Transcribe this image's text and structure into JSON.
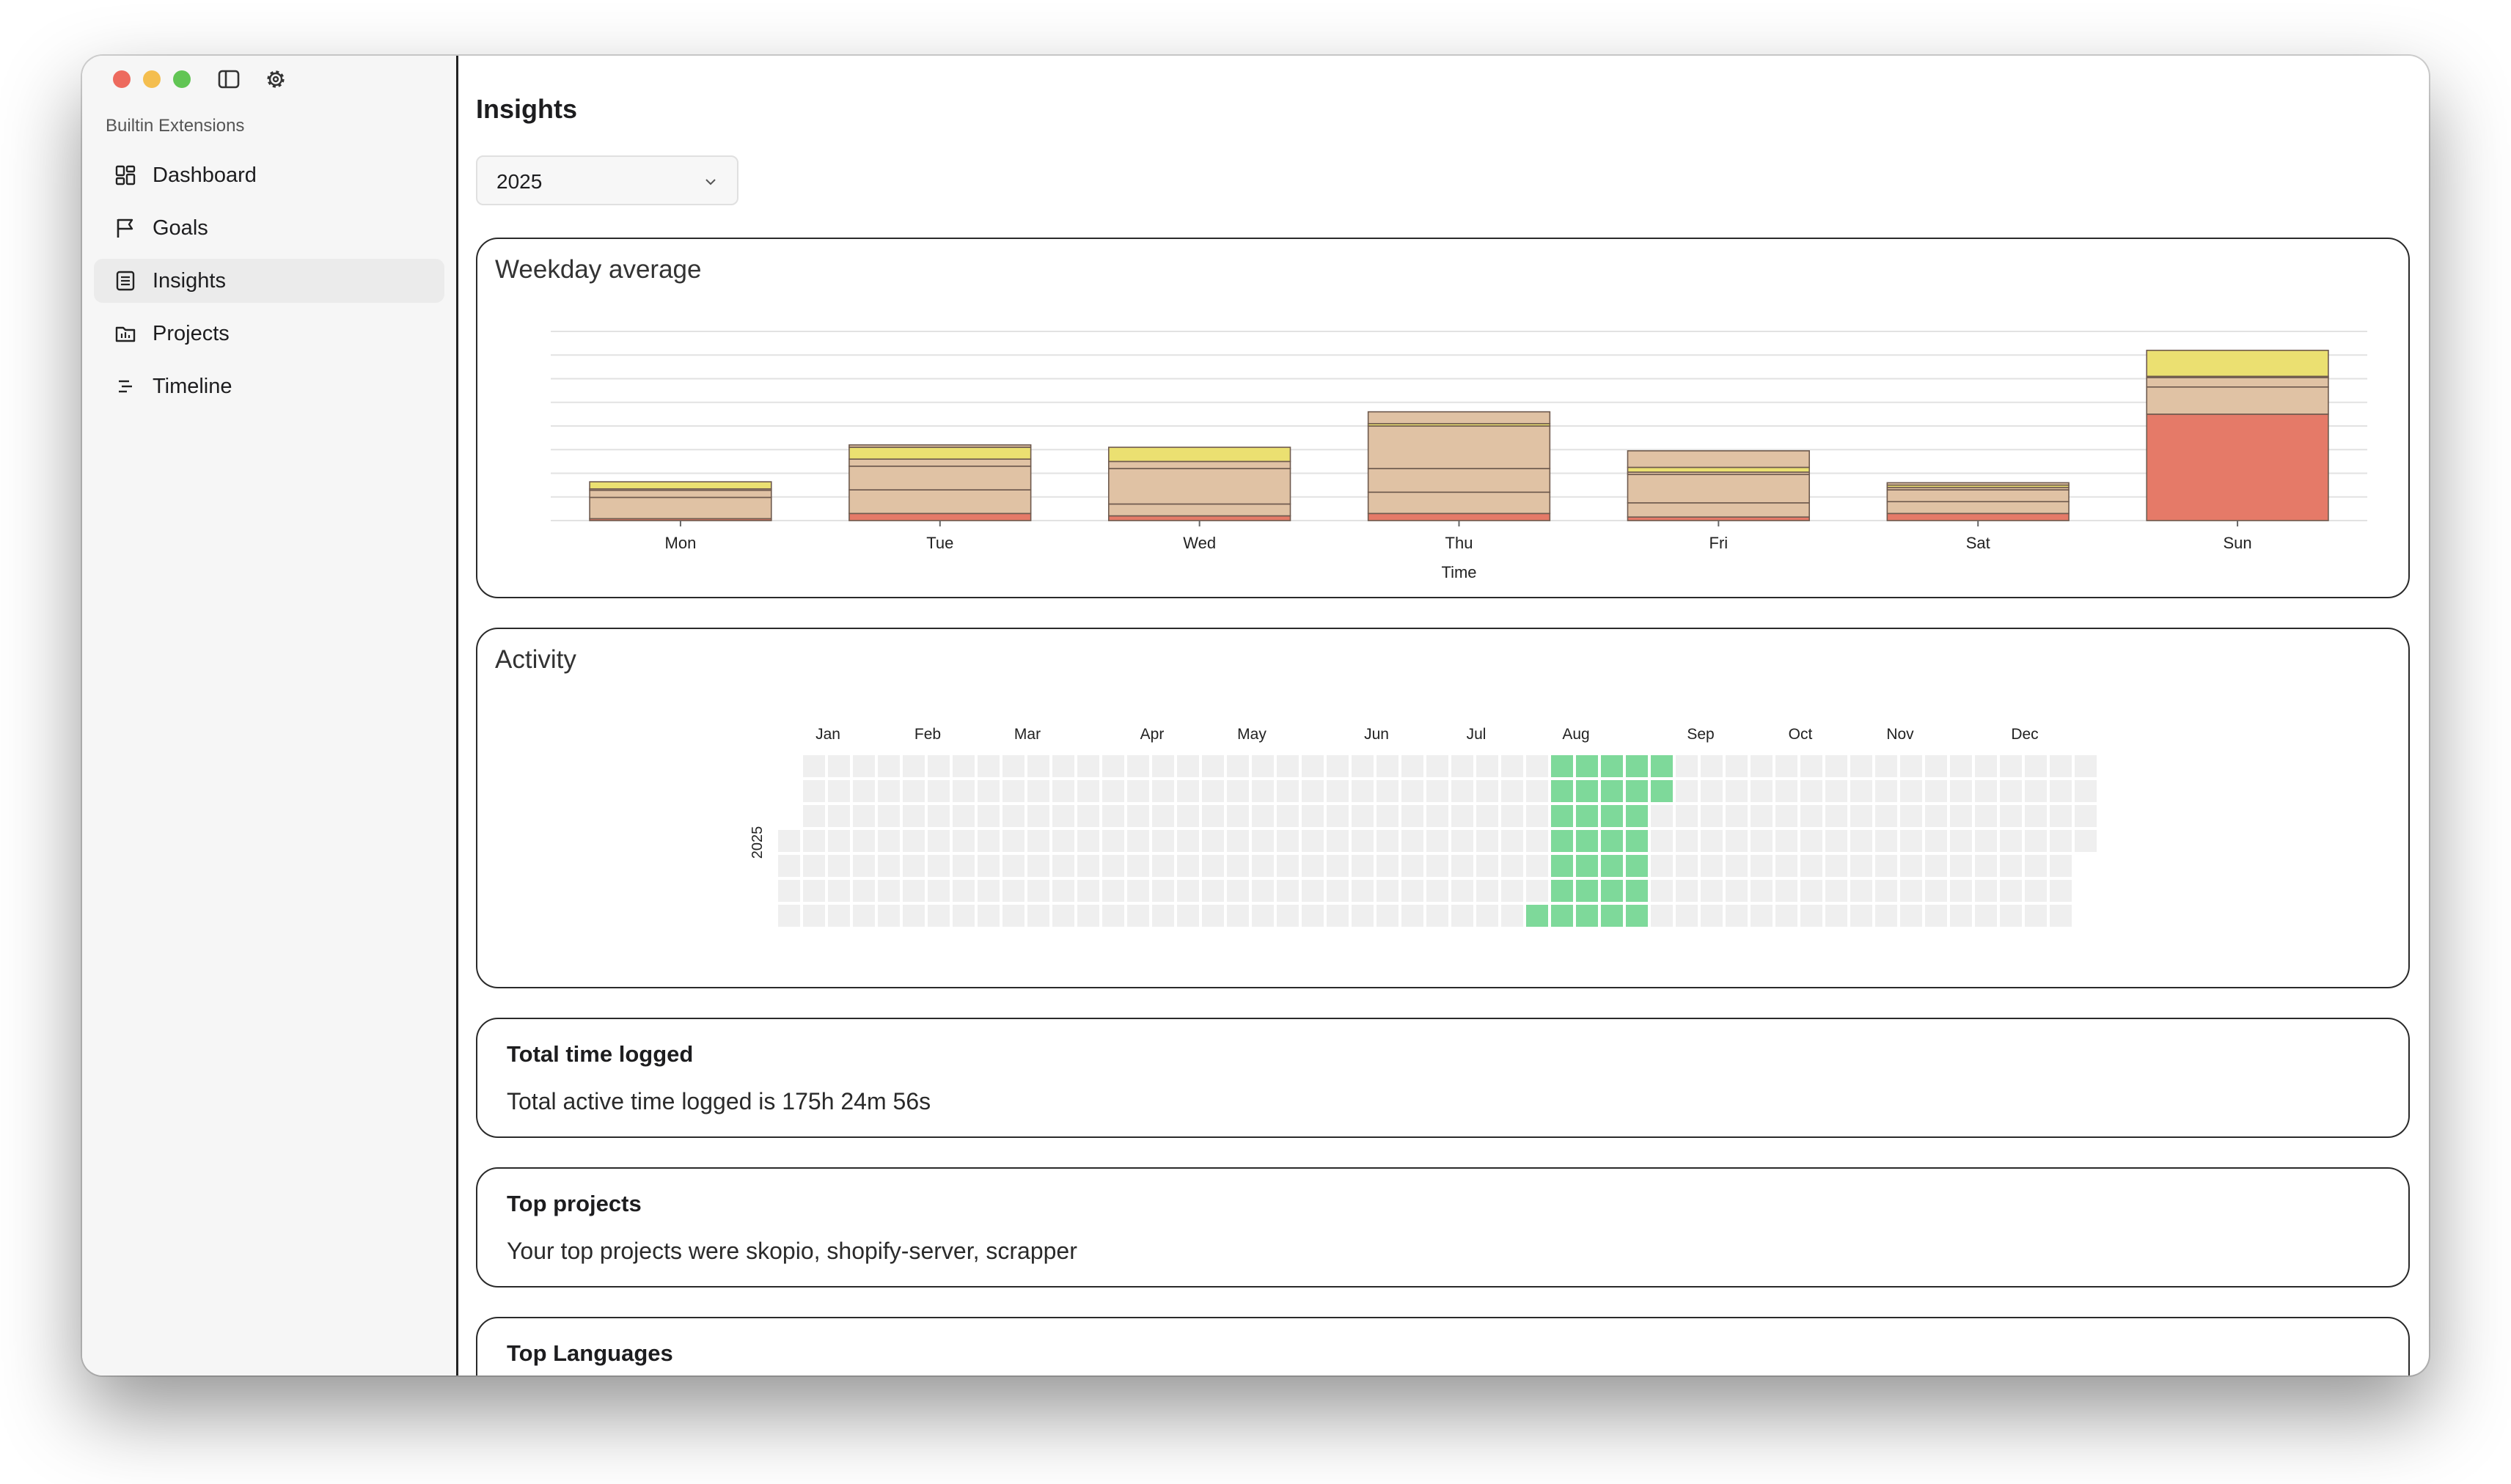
{
  "sidebar": {
    "section": "Builtin Extensions",
    "items": [
      {
        "label": "Dashboard",
        "icon": "dashboard-icon"
      },
      {
        "label": "Goals",
        "icon": "flag-icon"
      },
      {
        "label": "Insights",
        "icon": "insights-icon",
        "active": true
      },
      {
        "label": "Projects",
        "icon": "folder-icon"
      },
      {
        "label": "Timeline",
        "icon": "timeline-icon"
      }
    ]
  },
  "main": {
    "title": "Insights",
    "year_select": {
      "value": "2025"
    }
  },
  "weekday_card": {
    "title": "Weekday average"
  },
  "activity_card": {
    "title": "Activity"
  },
  "total_card": {
    "title": "Total time logged",
    "text": "Total active time logged is 175h 24m 56s"
  },
  "projects_card": {
    "title": "Top projects",
    "text": "Your top projects were skopio, shopify-server, scrapper"
  },
  "languages_card": {
    "title": "Top Languages"
  },
  "colors": {
    "accent_green": "#7ed99a",
    "cell_empty": "#efefef",
    "bar_red": "#e57a68",
    "bar_tan": "#e0c2a4",
    "bar_yellow": "#ebe071"
  },
  "chart_data": [
    {
      "type": "bar",
      "stacked": true,
      "categories": [
        "Mon",
        "Tue",
        "Wed",
        "Thu",
        "Fri",
        "Sat",
        "Sun"
      ],
      "xlabel": "Time",
      "ylabel": "",
      "ylim": [
        0,
        8
      ],
      "grid": true,
      "series": [
        {
          "color": "#e57a68",
          "values": [
            0.08,
            0.3,
            0.2,
            0.3,
            0.15,
            0.3,
            4.5
          ]
        },
        {
          "color": "#e0c2a4",
          "values": [
            0.9,
            1.0,
            0.5,
            0.9,
            0.6,
            0.5,
            1.15
          ]
        },
        {
          "color": "#e0c2a4",
          "values": [
            0.3,
            1.0,
            1.5,
            1.0,
            1.2,
            0.5,
            0.4
          ]
        },
        {
          "color": "#e0c2a4",
          "values": [
            0.06,
            0.3,
            0.3,
            1.8,
            0.1,
            0.1,
            0.05
          ]
        },
        {
          "color": "#ebe071",
          "values": [
            0.3,
            0.5,
            0.6,
            0.1,
            0.2,
            0.1,
            1.1
          ]
        },
        {
          "color": "#e0c2a4",
          "values": [
            0.0,
            0.1,
            0.0,
            0.5,
            0.7,
            0.1,
            0.0
          ]
        }
      ]
    },
    {
      "type": "heatmap",
      "year": "2025",
      "months": [
        "Jan",
        "Feb",
        "Mar",
        "Apr",
        "May",
        "Jun",
        "Jul",
        "Aug",
        "Sep",
        "Oct",
        "Nov",
        "Dec"
      ],
      "active_dates": [
        "2025-08-02",
        "2025-08-03",
        "2025-08-04",
        "2025-08-05",
        "2025-08-06",
        "2025-08-07",
        "2025-08-08",
        "2025-08-09",
        "2025-08-10",
        "2025-08-11",
        "2025-08-12",
        "2025-08-13",
        "2025-08-14",
        "2025-08-15",
        "2025-08-16",
        "2025-08-17",
        "2025-08-18",
        "2025-08-19",
        "2025-08-20",
        "2025-08-21",
        "2025-08-22",
        "2025-08-23",
        "2025-08-24",
        "2025-08-25",
        "2025-08-26",
        "2025-08-27",
        "2025-08-28",
        "2025-08-29",
        "2025-08-30",
        "2025-08-31",
        "2025-09-01"
      ]
    }
  ]
}
